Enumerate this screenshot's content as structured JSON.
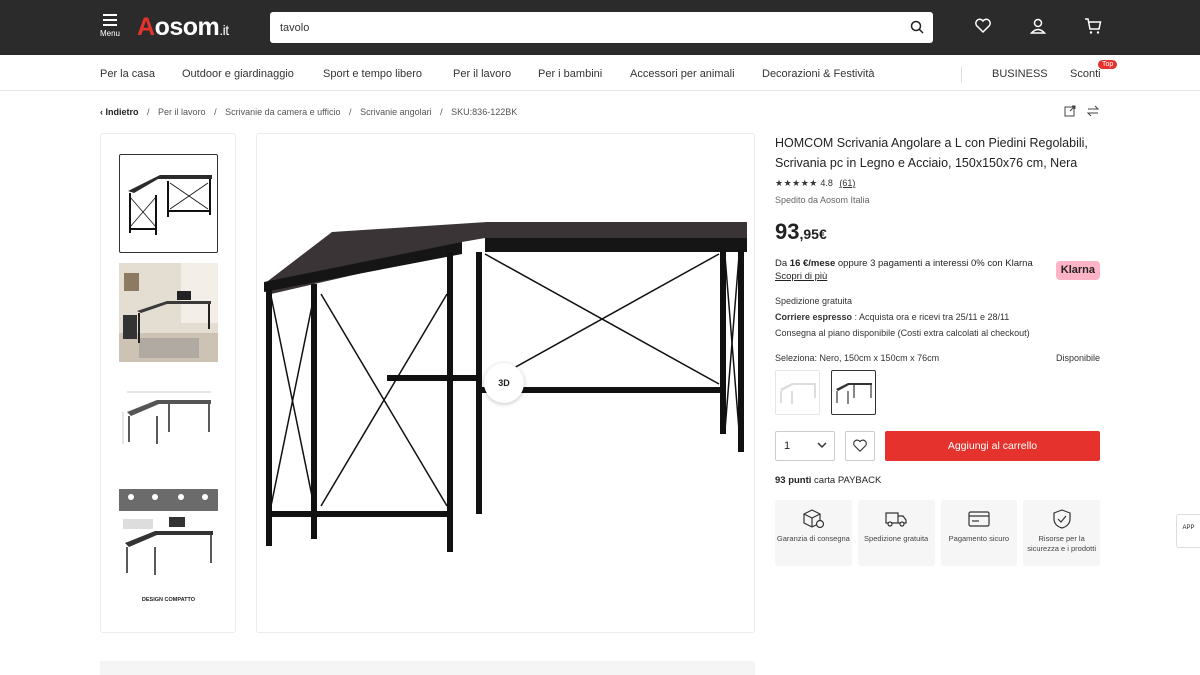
{
  "header": {
    "menu_label": "Menu",
    "logo_a": "A",
    "logo_rest": "osom",
    "logo_tld": ".it",
    "search_value": "tavolo"
  },
  "nav": {
    "items": [
      "Per la casa",
      "Outdoor e giardinaggio",
      "Sport e tempo libero",
      "Per il lavoro",
      "Per i bambini",
      "Accessori per animali",
      "Decorazioni & Festività"
    ],
    "business": "BUSINESS",
    "sconti": "Sconti",
    "sconti_badge": "Top"
  },
  "breadcrumb": {
    "back": "Indietro",
    "items": [
      "Per il lavoro",
      "Scrivanie da camera e ufficio",
      "Scrivanie angolari",
      "SKU:836-122BK"
    ],
    "sep": "/"
  },
  "main_image": {
    "badge_3d": "3D"
  },
  "product": {
    "title": "HOMCOM Scrivania Angolare a L con Piedini Regolabili, Scrivania pc in Legno e Acciaio, 150x150x76 cm, Nera",
    "stars": "★★★★★",
    "rating": "4.8",
    "reviews": "(61)",
    "shipped_by": "Spedito da Aosom Italia",
    "price_int": "93",
    "price_dec": ",95€",
    "klarna_text_pre": "Da ",
    "klarna_amount": "16 €/mese",
    "klarna_text_post": " oppure 3 pagamenti a interessi 0% con Klarna",
    "klarna_link": "Scopri di più",
    "klarna_badge": "Klarna",
    "shipping_free": "Spedizione gratuita",
    "courier_label": "Corriere espresso",
    "courier_text": " : Acquista ora e ricevi tra 25/11 e 28/11",
    "floor_delivery": "Consegna al piano disponibile (Costi extra calcolati al checkout)",
    "select_label": "Seleziona: Nero, 150cm x 150cm x 76cm",
    "availability": "Disponibile",
    "qty": "1",
    "add_to_cart": "Aggiungi al carrello",
    "payback_points": "93 punti",
    "payback_text": " carta PAYBACK"
  },
  "features": [
    {
      "icon": "warranty-box-icon",
      "label": "Garanzia di consegna"
    },
    {
      "icon": "delivery-truck-icon",
      "label": "Spedizione gratuita"
    },
    {
      "icon": "credit-card-icon",
      "label": "Pagamento sicuro"
    },
    {
      "icon": "shield-check-icon",
      "label": "Risorse per la sicurezza e i prodotti"
    }
  ],
  "app_tab": "APP",
  "thumb4_caption": "DESIGN COMPATTO",
  "colors": {
    "accent": "#e5322d",
    "topbar": "#2b2b2b",
    "klarna": "#ffb3c7"
  }
}
